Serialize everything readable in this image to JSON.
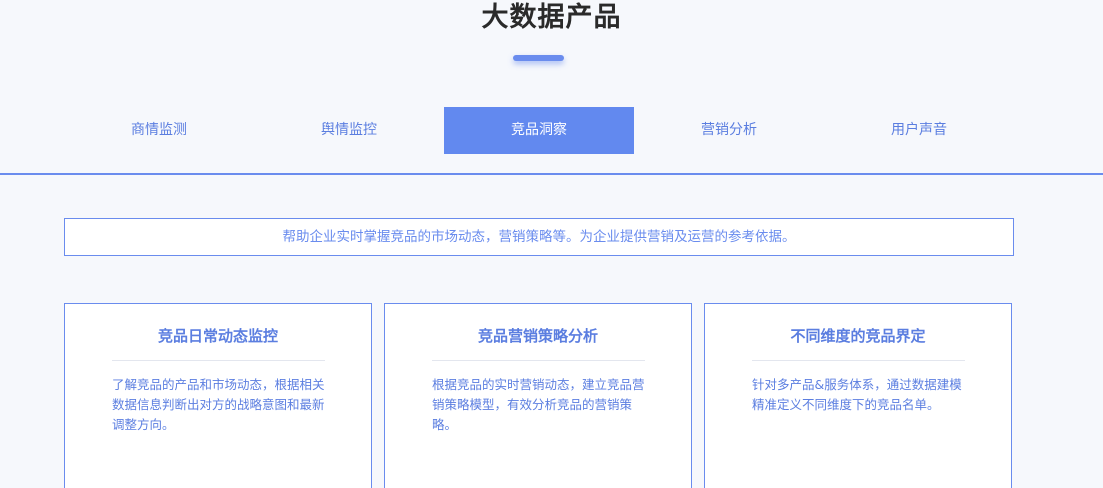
{
  "header": {
    "title": "大数据产品"
  },
  "tabs": [
    {
      "label": "商情监测",
      "active": false
    },
    {
      "label": "舆情监控",
      "active": false
    },
    {
      "label": "竞品洞察",
      "active": true
    },
    {
      "label": "营销分析",
      "active": false
    },
    {
      "label": "用户声音",
      "active": false
    }
  ],
  "description": "帮助企业实时掌握竞品的市场动态，营销策略等。为企业提供营销及运营的参考依据。",
  "cards": [
    {
      "title": "竞品日常动态监控",
      "text": "了解竞品的产品和市场动态，根据相关数据信息判断出对方的战略意图和最新调整方向。"
    },
    {
      "title": "竞品营销策略分析",
      "text": "根据竞品的实时营销动态，建立竞品营销策略模型，有效分析竞品的营销策略。"
    },
    {
      "title": "不同维度的竞品界定",
      "text": "针对多产品&服务体系，通过数据建模精准定义不同维度下的竞品名单。"
    }
  ],
  "colors": {
    "accent": "#6289ef",
    "text_accent": "#5b7ee0",
    "background": "#f6f8fc",
    "title": "#2a2a2a"
  }
}
